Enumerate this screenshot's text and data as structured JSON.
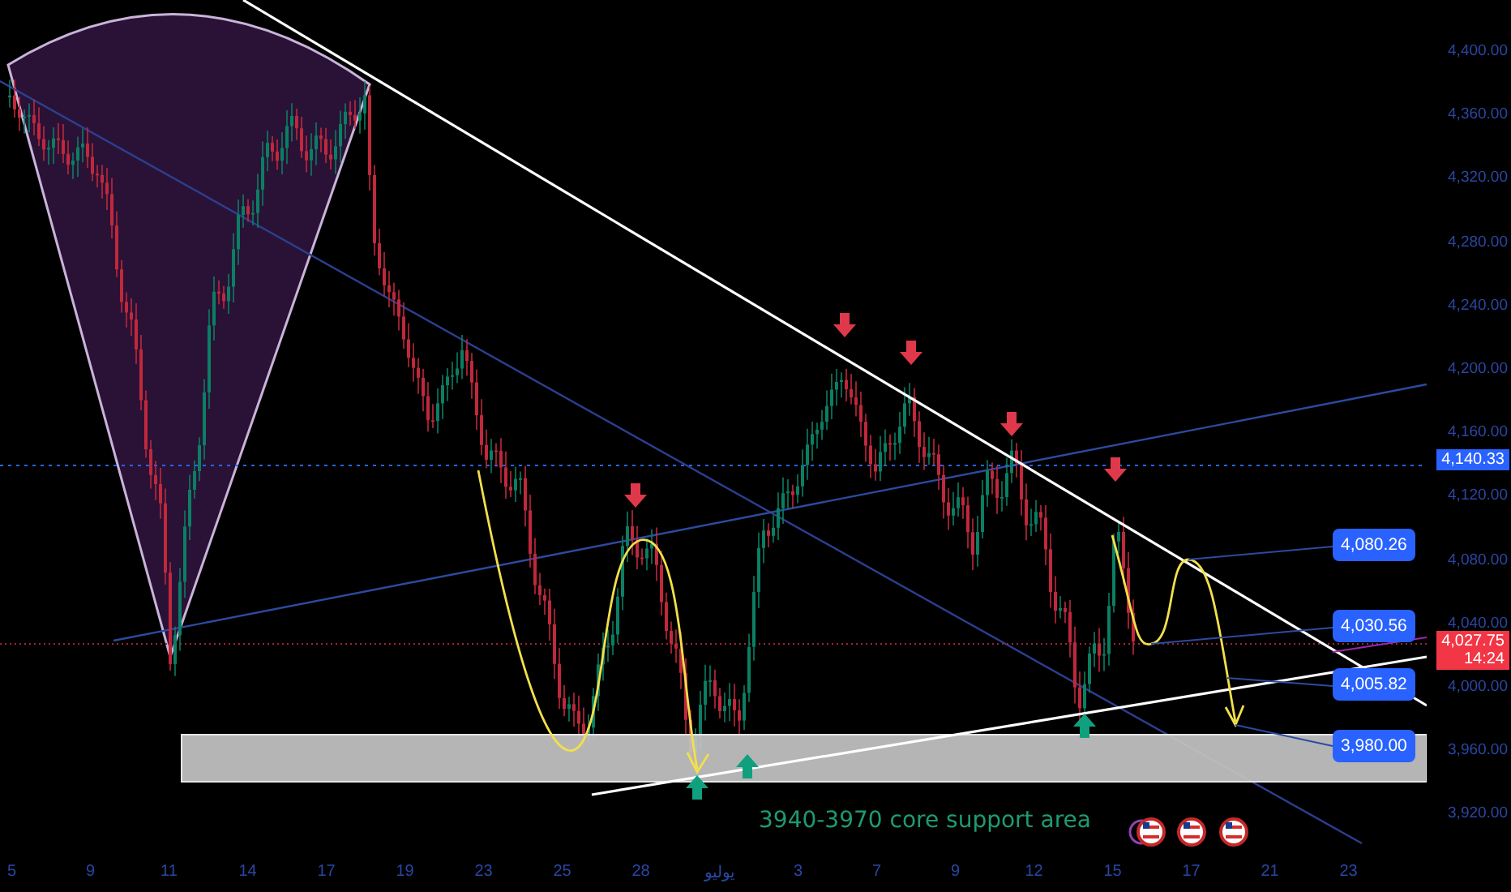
{
  "price_axis": {
    "ticks": [
      "4,400.00",
      "4,360.00",
      "4,320.00",
      "4,280.00",
      "4,240.00",
      "4,200.00",
      "4,160.00",
      "4,120.00",
      "4,080.00",
      "4,040.00",
      "4,000.00",
      "3,960.00",
      "3,920.00"
    ],
    "crosshair_price": "4,140.33",
    "current_price": {
      "price": "4,027.75",
      "countdown": "14:24"
    }
  },
  "time_axis": {
    "labels": [
      "5",
      "9",
      "11",
      "14",
      "17",
      "19",
      "23",
      "25",
      "28",
      "يوليو",
      "3",
      "7",
      "9",
      "12",
      "15",
      "17",
      "21",
      "23"
    ]
  },
  "level_labels": [
    "4,080.26",
    "4,030.56",
    "4,005.82",
    "3,980.00"
  ],
  "support_note": "3940-3970 core support area"
}
